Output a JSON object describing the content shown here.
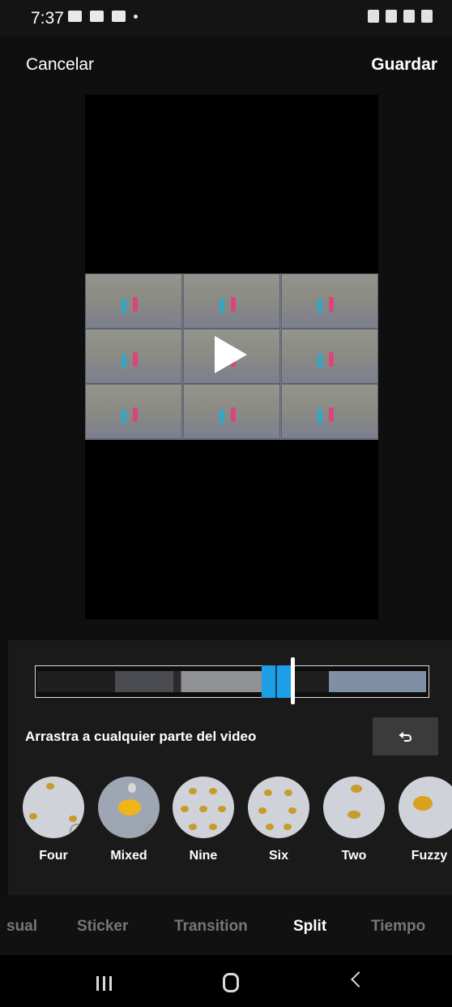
{
  "status_bar": {
    "time": "7:37",
    "left_icons": [
      "gallery-icon",
      "weather-icon",
      "cloud-icon",
      "notification-dot-icon"
    ],
    "right_icons": [
      "battery-saver-icon",
      "wifi-icon",
      "signal-icon",
      "battery-icon"
    ]
  },
  "header": {
    "cancel_label": "Cancelar",
    "save_label": "Guardar"
  },
  "preview": {
    "play_icon": "play-icon"
  },
  "editor": {
    "hint": "Arrastra a cualquier parte del video",
    "undo_icon": "undo-icon",
    "timeline_progress": 0.66
  },
  "effects": [
    {
      "label": "Four"
    },
    {
      "label": "Mixed"
    },
    {
      "label": "Nine"
    },
    {
      "label": "Six"
    },
    {
      "label": "Two"
    },
    {
      "label": "Fuzzy"
    }
  ],
  "tabs": [
    {
      "label": "sual"
    },
    {
      "label": "Sticker"
    },
    {
      "label": "Transition"
    },
    {
      "label": "Split"
    },
    {
      "label": "Tiempo"
    }
  ],
  "active_tab": "Split",
  "nav": {
    "recent_icon": "recent-apps-icon",
    "home_icon": "home-icon",
    "back_icon": "back-icon"
  },
  "colors": {
    "accent_blue": "#1d9ee6",
    "background": "#0f0f0f"
  }
}
